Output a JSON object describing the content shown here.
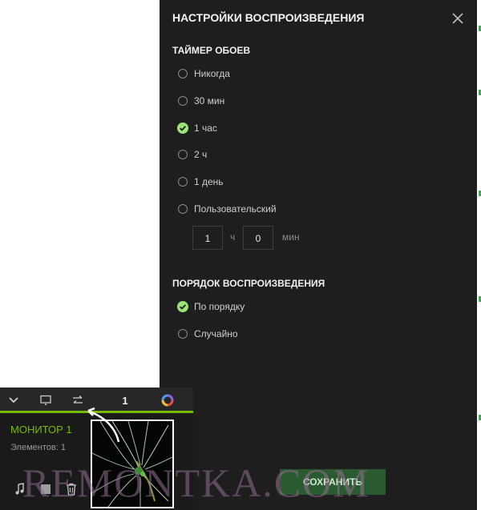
{
  "panel": {
    "title": "НАСТРОЙКИ ВОСПРОИЗВЕДЕНИЯ",
    "timer_section": {
      "title": "ТАЙМЕР ОБОЕВ",
      "options": [
        {
          "label": "Никогда",
          "checked": false
        },
        {
          "label": "30 мин",
          "checked": false
        },
        {
          "label": "1 час",
          "checked": true
        },
        {
          "label": "2 ч",
          "checked": false
        },
        {
          "label": "1 день",
          "checked": false
        },
        {
          "label": "Пользовательский",
          "checked": false
        }
      ],
      "custom": {
        "hours": "1",
        "hours_unit": "ч",
        "minutes": "0",
        "minutes_unit": "мин"
      }
    },
    "order_section": {
      "title": "ПОРЯДОК ВОСПРОИЗВЕДЕНИЯ",
      "options": [
        {
          "label": "По порядку",
          "checked": true
        },
        {
          "label": "Случайно",
          "checked": false
        }
      ]
    },
    "save_label": "СОХРАНИТЬ"
  },
  "toolbar": {
    "count": "1"
  },
  "monitor": {
    "title": "МОНИТОР 1",
    "items_label": "Элементов: 1"
  },
  "watermark": "REMONTKA.COM",
  "colors": {
    "accent": "#76b900",
    "check": "#9be37a",
    "panel_bg": "#1e1e1e"
  }
}
